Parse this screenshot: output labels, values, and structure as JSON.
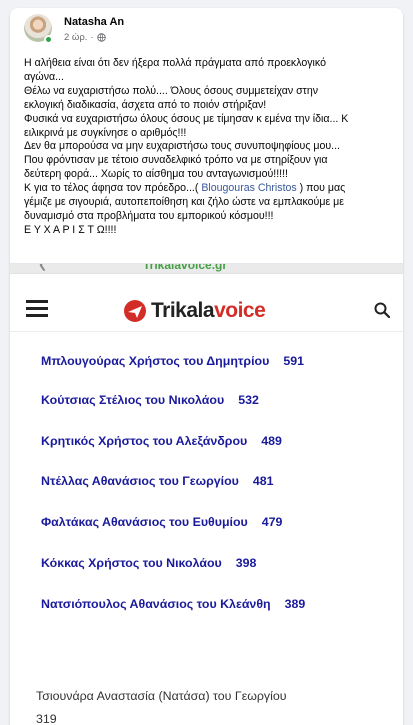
{
  "post": {
    "author": "Natasha An",
    "time": "2 ώρ.",
    "privacy_icon": "globe-icon",
    "text_lines": [
      "Η αλήθεια είναι ότι δεν ήξερα πολλά πράγματα από προεκλογικό",
      "αγώνα...",
      "Θέλω να ευχαριστήσω πολύ.... Όλους όσους συμμετείχαν στην",
      "εκλογική διαδικασία, άσχετα από το ποιόν στήριξαν!",
      "Φυσικά να ευχαριστήσω όλους όσους με τίμησαν κ εμένα την ίδια... Κ",
      "ειλικρινά με συγκίνησε ο αριθμός!!!",
      "Δεν θα μπορούσα να μην ευχαριστήσω τους συνυποψηφίους μου...",
      "Που φρόντισαν με τέτοιο συναδελφικό τρόπο να με στηρίξουν για",
      "δεύτερη φορά... Χωρίς το αίσθημα του ανταγωνισμού!!!!!"
    ],
    "mention_before": "Κ για το τέλος άφησα τον πρόεδρο...( ",
    "mention": "Blougouras Christos",
    "mention_after": " ) που μας",
    "text_lines_after": [
      "γέμιζε με σιγουριά, αυτοπεποίθηση και ζήλο ώστε να εμπλακούμε με",
      "δυναμισμό στα προβλήματα του εμπορικού κόσμου!!!",
      "Ε Υ Χ Α Ρ Ι Σ Τ Ω!!!!"
    ]
  },
  "photo": {
    "strip_chevron": "❮",
    "strip_url": "Trikalavoice.gr",
    "site_logo_part1": "Trikala",
    "site_logo_part2": "voice",
    "brand_red": "#d32d27",
    "candidate_color": "#1a1a9c",
    "candidates": [
      {
        "name": "Μπλουγούρας Χρήστος του Δημητρίου",
        "votes": "591"
      },
      {
        "name": "Κούτσιας Στέλιος του Νικολάου",
        "votes": "532"
      },
      {
        "name": "Κρητικός Χρήστος του Αλεξάνδρου",
        "votes": "489"
      },
      {
        "name": "Ντέλλας Αθανάσιος του Γεωργίου",
        "votes": "481"
      },
      {
        "name": "Φαλτάκας Αθανάσιος του Ευθυμίου",
        "votes": "479"
      },
      {
        "name": "Κόκκας Χρήστος του Νικολάου",
        "votes": "398"
      },
      {
        "name": "Νατσιόπουλος Αθανάσιος του Κλεάνθη",
        "votes": "389"
      }
    ],
    "bottom_candidate_name": "Τσιουνάρα Αναστασία (Νατάσα) του Γεωργίου",
    "bottom_candidate_votes": "319"
  }
}
